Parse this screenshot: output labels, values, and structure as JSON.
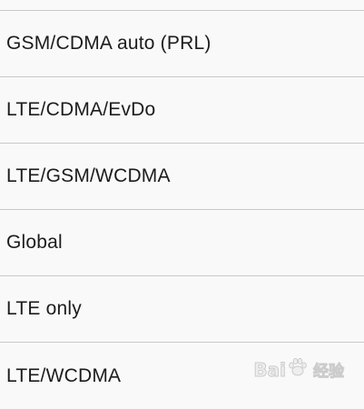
{
  "network_mode_options": [
    {
      "label": "GSM/CDMA auto (PRL)"
    },
    {
      "label": "LTE/CDMA/EvDo"
    },
    {
      "label": "LTE/GSM/WCDMA"
    },
    {
      "label": "Global"
    },
    {
      "label": "LTE only"
    },
    {
      "label": "LTE/WCDMA"
    }
  ],
  "watermark": {
    "text_left": "Bai",
    "text_right": "经验",
    "icon": "paw-icon"
  },
  "colors": {
    "background": "#f9f9f9",
    "divider": "#c9c9c9",
    "text": "#1c1c1c"
  }
}
